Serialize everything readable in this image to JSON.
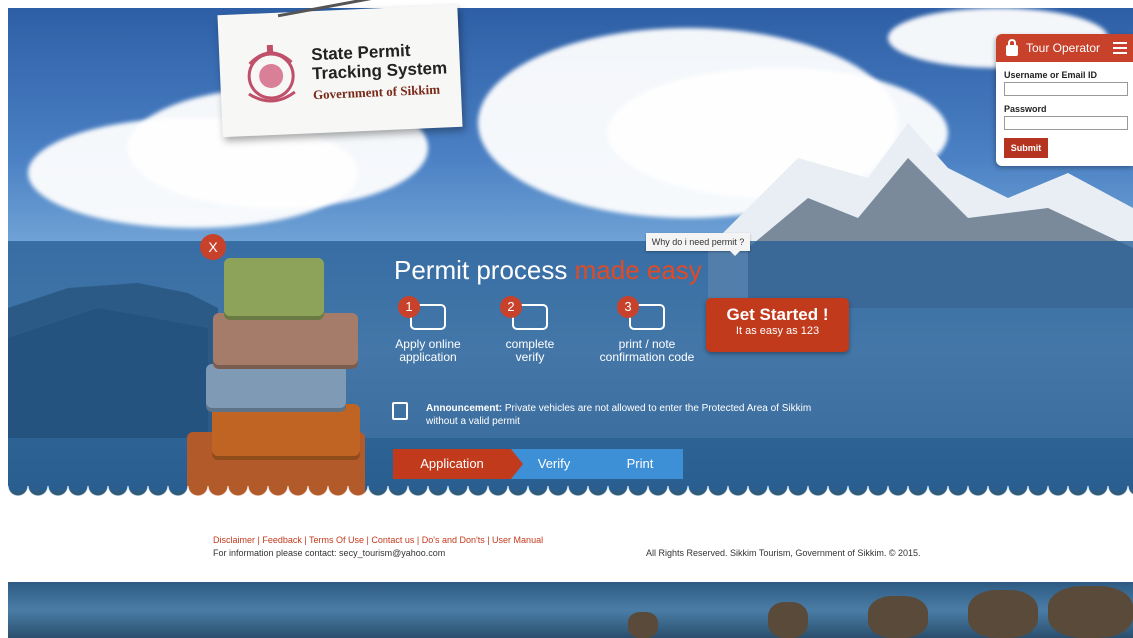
{
  "header": {
    "title_line1": "State Permit",
    "title_line2": "Tracking System",
    "subtitle": "Government of Sikkim"
  },
  "login": {
    "heading": "Tour Operator",
    "username_label": "Username or Email ID",
    "username_value": "",
    "password_label": "Password",
    "password_value": "",
    "submit_label": "Submit"
  },
  "banner": {
    "close_label": "X",
    "tooltip": "Why do i need permit ?",
    "headline_plain": "Permit process",
    "headline_accent": "made easy",
    "steps": [
      {
        "number": "1",
        "label_line1": "Apply online",
        "label_line2": "application"
      },
      {
        "number": "2",
        "label_line1": "complete",
        "label_line2": "verify"
      },
      {
        "number": "3",
        "label_line1": "print / note",
        "label_line2": "confirmation code"
      }
    ],
    "get_started_title": "Get Started !",
    "get_started_sub": "It as easy as 123",
    "announcement_label": "Announcement:",
    "announcement_text": "Private vehicles are not allowed to enter the Protected Area of Sikkim without a valid permit",
    "crumbs": [
      "Application",
      "Verify",
      "Print"
    ]
  },
  "footer": {
    "links": "Disclaimer | Feedback | Terms Of Use | Contact us | Do's and Don'ts | User Manual",
    "contact": "For information please contact: secy_tourism@yahoo.com",
    "copyright": "All Rights Reserved. Sikkim Tourism, Government of Sikkim. © 2015."
  },
  "colors": {
    "accent": "#c23a1c",
    "band": "#285f96",
    "crumb_blue": "#3d8fd6"
  }
}
